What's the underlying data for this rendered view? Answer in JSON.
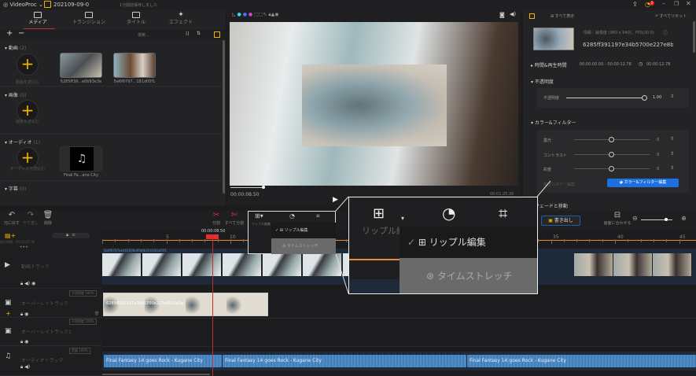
{
  "app": {
    "name": "VideoProc",
    "project": "202109-09-0",
    "save_status": "1分間前保存しました",
    "notification_count": "2"
  },
  "media_tabs": [
    {
      "label": "メディア",
      "active": true
    },
    {
      "label": "トランジション"
    },
    {
      "label": "タイトル"
    },
    {
      "label": "エフェクト"
    }
  ],
  "media_toolbar": {
    "add": "+",
    "remove": "−",
    "search_placeholder": "検索..."
  },
  "sections": [
    {
      "title": "動画",
      "count": "(2)",
      "import": "動画を読込む",
      "items": [
        "6285ff39...e0b93e3e",
        "5e6f6797...181d05f1"
      ]
    },
    {
      "title": "画像",
      "count": "(0)",
      "import": "画像を読込む",
      "items": []
    },
    {
      "title": "オーディオ",
      "count": "(1)",
      "import": "オーディオを読込む",
      "items": [
        "Final Fa...ane City"
      ]
    },
    {
      "title": "字幕",
      "count": "(0)"
    }
  ],
  "preview": {
    "current_time": "00:00:08.50",
    "total_time": "00:01:25.30",
    "colors": [
      "#3fd8e8",
      "#3a7bff",
      "#e040e0"
    ]
  },
  "inspector": {
    "show_all": "すべて表示",
    "reset_all": "すべてリセット",
    "info": "情報：解像度 (960 x 540)、FPS(30.0)",
    "clip_name": "6285ff391197e34b5700e227e8b9",
    "time_section": "時間&再生時間",
    "time_range": "00:00:00.00 - 00:00:12.78",
    "duration": "00:00:12.78",
    "opacity_section": "不透明度",
    "opacity_label": "不透明度",
    "opacity_value": "1.00",
    "opacity_level": 1.0,
    "color_section": "カラー&フィルター",
    "adjust": [
      {
        "label": "露光",
        "value": "0"
      },
      {
        "label": "コントラスト",
        "value": "0"
      },
      {
        "label": "彩度",
        "value": "0"
      }
    ],
    "advanced_label": "高度なカラー編集",
    "advanced_button": "カラー&フィルター編集",
    "fade_section": "フェードと移動"
  },
  "timeline_toolbar": {
    "undo": "元に戻す",
    "redo": "やり直し",
    "delete": "削除",
    "split": "分割",
    "split_all": "すべて分割",
    "ripple": "リップル編集",
    "transition": "トランジション",
    "export": "書き出し",
    "fit": "画面に合わせる"
  },
  "ruler": {
    "playhead": "00:00:08.50",
    "labels": [
      "5",
      "10",
      "35",
      "40",
      "45"
    ],
    "duration_label": "再生時間：00:01:25.30"
  },
  "tracks": {
    "video": {
      "name": "動画トラック",
      "clip": "5e6f6797ae401006a9fa6b314181a05f1"
    },
    "overlay": {
      "name": "オーバーレイトラック",
      "opacity": "不透明度 100%",
      "clip": "6285ff391197e34b5700e227e8b93e3e"
    },
    "overlay1": {
      "name": "オーバーレイトラック1",
      "opacity": "不透明度 100%"
    },
    "audio": {
      "name": "オーディオトラック",
      "volume": "音量 100%",
      "clip": "Final Fantasy 14 goes Rock - Kugane City"
    }
  },
  "menu": {
    "items": [
      {
        "label": "リップル編集",
        "checked": true
      },
      {
        "label": "タイムストレッチ",
        "checked": false
      }
    ]
  },
  "colors": {
    "accent": "#f0b400",
    "playhead": "#e03030",
    "button_blue": "#1e6fe0",
    "ruler": "#e88a3c"
  }
}
